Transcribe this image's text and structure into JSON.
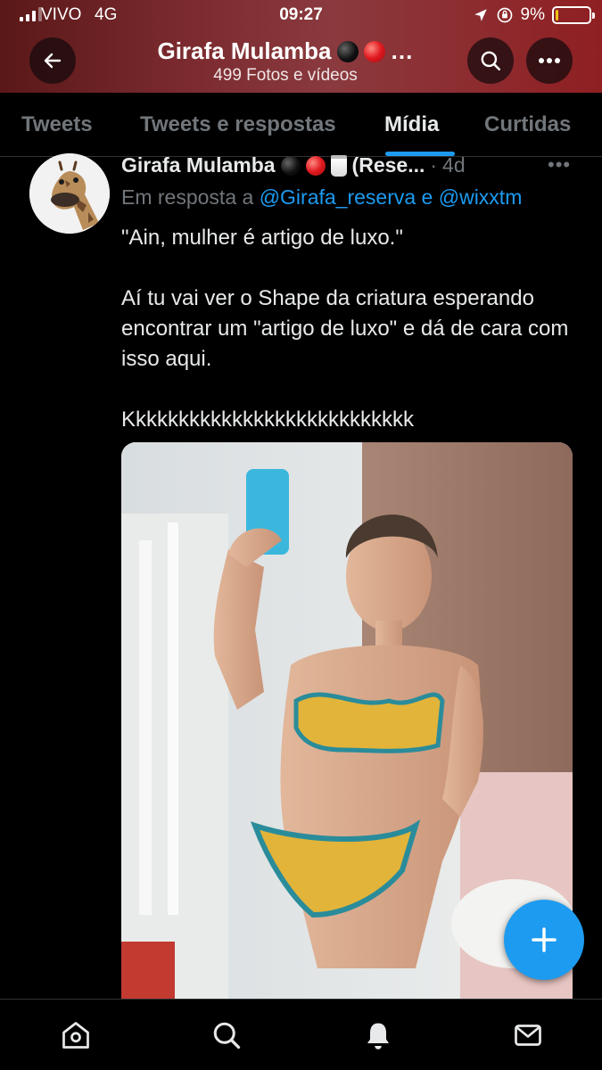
{
  "status_bar": {
    "carrier": "VIVO",
    "network": "4G",
    "time": "09:27",
    "battery_percent": "9%",
    "battery_level": 0.09,
    "signal_bars_active": 3,
    "signal_bars_total": 4
  },
  "header": {
    "title": "Girafa Mulamba",
    "title_suffix": "…",
    "subtitle": "499 Fotos e vídeos"
  },
  "tabs": [
    {
      "label": "Tweets",
      "active": false
    },
    {
      "label": "Tweets e respostas",
      "active": false
    },
    {
      "label": "Mídia",
      "active": true
    },
    {
      "label": "Curtidas",
      "active": false
    }
  ],
  "tweet": {
    "author_name": "Girafa Mulamba",
    "author_handle_truncated": "(Rese...",
    "separator": "·",
    "timestamp": "4d",
    "more_label": "•••",
    "reply_prefix": "Em resposta a",
    "reply_mention_1": "@Girafa_reserva",
    "reply_conjunction": "e",
    "reply_mention_2": "@wixxtm",
    "paragraphs": [
      "\"Ain, mulher é artigo de luxo.\"",
      "Aí tu vai ver o Shape da criatura esperando encontrar um \"artigo de luxo\" e dá de cara com isso aqui.",
      "Kkkkkkkkkkkkkkkkkkkkkkkkkkk"
    ]
  },
  "bottom_nav": [
    {
      "icon": "home-icon"
    },
    {
      "icon": "search-icon"
    },
    {
      "icon": "notifications-bell-icon"
    },
    {
      "icon": "messages-envelope-icon"
    }
  ],
  "colors": {
    "accent": "#1d9bf0",
    "header_red": "#8f1f22",
    "text_primary": "#e7e9ea",
    "text_secondary": "#71767b"
  }
}
